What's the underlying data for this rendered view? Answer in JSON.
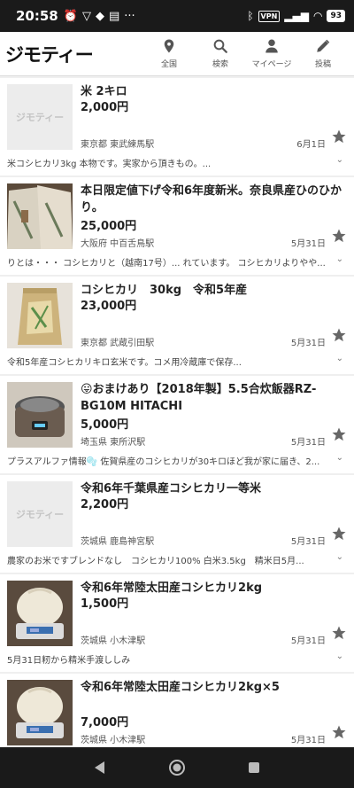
{
  "status_bar": {
    "time": "20:58",
    "vpn": "VPN",
    "battery": "93"
  },
  "app": {
    "logo": "ジモティー",
    "nav": [
      {
        "label": "全国",
        "icon": "location-pin-icon"
      },
      {
        "label": "検索",
        "icon": "search-icon"
      },
      {
        "label": "マイページ",
        "icon": "person-icon"
      },
      {
        "label": "投稿",
        "icon": "pencil-icon"
      }
    ]
  },
  "listings": [
    {
      "title": "米 2キロ",
      "price": "2,000円",
      "location": "東京都 東武練馬駅",
      "date": "6月1日",
      "description": "米コシヒカリ3kg 本物です。実家から頂きもの。...",
      "thumb": "placeholder",
      "placeholder_text": "ジモティー"
    },
    {
      "title": "本日限定値下げ令和6年度新米。奈良県産ひのひかり。",
      "price": "25,000円",
      "location": "大阪府 中百舌鳥駅",
      "date": "5月31日",
      "description": "りとは・・・ コシヒカリと（越南17号）... れています。 コシヒカリよりやや...",
      "thumb": "rice-sacks"
    },
    {
      "title": "コシヒカリ　30kg　令和5年産",
      "price": "23,000円",
      "location": "東京都 武蔵引田駅",
      "date": "5月31日",
      "description": "令和5年産コシヒカリキロ玄米です。コメ用冷蔵庫で保存...",
      "thumb": "rice-bag"
    },
    {
      "title": "😛おまけあり【2018年製】5.5合炊飯器RZ-BG10M HITACHI",
      "price": "5,000円",
      "location": "埼玉県 東所沢駅",
      "date": "5月31日",
      "description": "プラスアルファ情報🫧 佐賀県産のコシヒカリが30キロほど我が家に届き、2...",
      "thumb": "rice-cooker"
    },
    {
      "title": "令和6年千葉県産コシヒカリ一等米",
      "price": "2,200円",
      "location": "茨城県 鹿島神宮駅",
      "date": "5月31日",
      "description": "農家のお米ですブレンドなし　コシヒカリ100% 白米3.5kg　精米日5月...",
      "thumb": "placeholder",
      "placeholder_text": "ジモティー"
    },
    {
      "title": "令和6年常陸太田産コシヒカリ2kg",
      "price": "1,500円",
      "location": "茨城県 小木津駅",
      "date": "5月31日",
      "description": "5月31日籾から精米手渡ししみ",
      "thumb": "rice-scale"
    },
    {
      "title": "令和6年常陸太田産コシヒカリ2kg×5",
      "price": "7,000円",
      "location": "茨城県 小木津駅",
      "date": "5月31日",
      "description": "",
      "thumb": "rice-scale"
    }
  ]
}
